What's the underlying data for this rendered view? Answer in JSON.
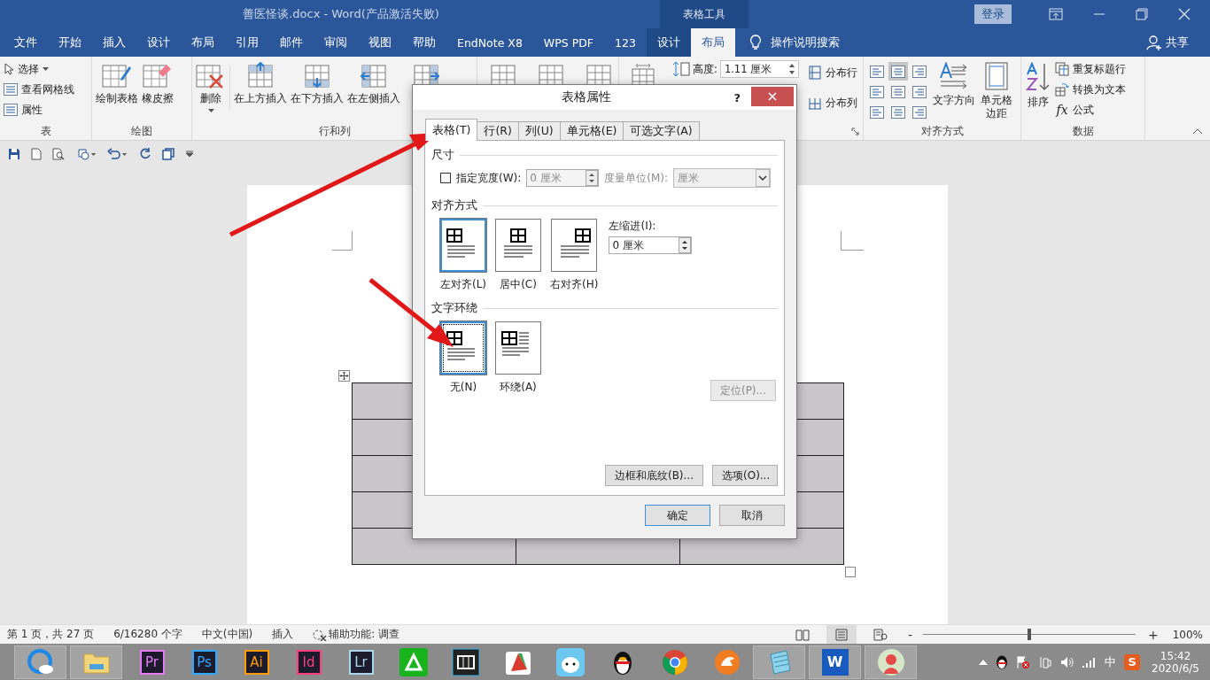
{
  "window": {
    "title": "善医怪谈.docx  -  Word(产品激活失败)",
    "context_group": "表格工具",
    "login": "登录"
  },
  "menu_tabs": [
    {
      "label": "文件",
      "kind": "main",
      "selected": false
    },
    {
      "label": "开始",
      "kind": "main",
      "selected": false
    },
    {
      "label": "插入",
      "kind": "main",
      "selected": false
    },
    {
      "label": "设计",
      "kind": "main",
      "selected": false
    },
    {
      "label": "布局",
      "kind": "main",
      "selected": false
    },
    {
      "label": "引用",
      "kind": "main",
      "selected": false
    },
    {
      "label": "邮件",
      "kind": "main",
      "selected": false
    },
    {
      "label": "审阅",
      "kind": "main",
      "selected": false
    },
    {
      "label": "视图",
      "kind": "main",
      "selected": false
    },
    {
      "label": "帮助",
      "kind": "main",
      "selected": false
    },
    {
      "label": "EndNote X8",
      "kind": "main",
      "selected": false
    },
    {
      "label": "WPS PDF",
      "kind": "main",
      "selected": false
    },
    {
      "label": "123",
      "kind": "main",
      "selected": false
    },
    {
      "label": "设计",
      "kind": "context",
      "selected": false
    },
    {
      "label": "布局",
      "kind": "context",
      "selected": true
    }
  ],
  "tell_me": "操作说明搜索",
  "share": "共享",
  "ribbon": {
    "table_group": {
      "label": "表",
      "select": "选择",
      "gridlines": "查看网格线",
      "properties": "属性"
    },
    "draw_group": {
      "label": "绘图",
      "draw_table": "绘制表格",
      "eraser": "橡皮擦"
    },
    "rows_cols_group": {
      "label": "行和列",
      "delete": "删除",
      "insert_above": "在上方插入",
      "insert_below": "在下方插入",
      "insert_left": "在左侧插入"
    },
    "cell_size_group": {
      "height_label": "高度:",
      "height_value": "1.11 厘米",
      "distribute_rows": "分布行",
      "distribute_cols": "分布列"
    },
    "alignment_group": {
      "label": "对齐方式",
      "alignments": [
        {
          "selected": false
        },
        {
          "selected": true
        },
        {
          "selected": false
        },
        {
          "selected": false
        },
        {
          "selected": false
        },
        {
          "selected": false
        },
        {
          "selected": false
        },
        {
          "selected": false
        },
        {
          "selected": false
        }
      ],
      "text_direction": "文字方向",
      "cell_margins": "单元格边距"
    },
    "data_group": {
      "label": "数据",
      "sort": "排序",
      "repeat_header": "重复标题行",
      "convert_to_text": "转换为文本",
      "formula_symbol": "fx",
      "formula": "公式"
    }
  },
  "dialog": {
    "title": "表格属性",
    "help": "?",
    "tabs": [
      {
        "label": "表格(T)",
        "selected": true
      },
      {
        "label": "行(R)",
        "selected": false
      },
      {
        "label": "列(U)",
        "selected": false
      },
      {
        "label": "单元格(E)",
        "selected": false
      },
      {
        "label": "可选文字(A)",
        "selected": false
      }
    ],
    "size": {
      "heading": "尺寸",
      "width_check": {
        "label": "指定宽度(W):",
        "checked": false
      },
      "width_field": {
        "value": "0 厘米",
        "disabled": true
      },
      "unit_label": "度量单位(M):",
      "unit_select": {
        "value": "厘米",
        "disabled": true
      }
    },
    "alignment": {
      "heading": "对齐方式",
      "options": [
        {
          "label": "左对齐(L)",
          "kind": "left",
          "selected": true
        },
        {
          "label": "居中(C)",
          "kind": "center",
          "selected": false
        },
        {
          "label": "右对齐(H)",
          "kind": "right",
          "selected": false
        }
      ],
      "indent_label": "左缩进(I):",
      "indent_value": "0 厘米"
    },
    "wrapping": {
      "heading": "文字环绕",
      "options": [
        {
          "label": "无(N)",
          "kind": "none",
          "selected": true
        },
        {
          "label": "环绕(A)",
          "kind": "around",
          "selected": false
        }
      ],
      "position_button": {
        "label": "定位(P)...",
        "disabled": true
      }
    },
    "borders_button": "边框和底纹(B)...",
    "options_button": "选项(O)...",
    "ok": "确定",
    "cancel": "取消"
  },
  "document": {
    "table": {
      "selected": true
    }
  },
  "status_bar": {
    "page": "第 1 页，共 27 页",
    "words": "6/16280 个字",
    "language": "中文(中国)",
    "mode": "插入",
    "accessibility": "辅助功能: 调查",
    "views": [
      {
        "selected": false
      },
      {
        "selected": true
      },
      {
        "selected": false
      }
    ],
    "zoom_out": "-",
    "zoom": {
      "level": 0.5
    },
    "zoom_in": "+",
    "zoom_percent": "100%"
  },
  "taskbar": {
    "apps": [
      {
        "kind": "cloud-browser",
        "open": true
      },
      {
        "kind": "folder",
        "open": true
      },
      {
        "kind": "adobe",
        "label": "Pr",
        "color": "#e77bf8",
        "open": false
      },
      {
        "kind": "adobe",
        "label": "Ps",
        "color": "#31a8ff",
        "open": false
      },
      {
        "kind": "adobe",
        "label": "Ai",
        "color": "#ff9a00",
        "open": false
      },
      {
        "kind": "adobe",
        "label": "Id",
        "color": "#ff3d7f",
        "open": false
      },
      {
        "kind": "adobe",
        "label": "Lr",
        "color": "#add5ec",
        "open": false
      },
      {
        "kind": "green-app",
        "open": false
      },
      {
        "kind": "film",
        "open": false
      },
      {
        "kind": "chart-app",
        "open": false
      },
      {
        "kind": "cat-app",
        "open": false
      },
      {
        "kind": "penguin",
        "open": false
      },
      {
        "kind": "chrome",
        "open": false
      },
      {
        "kind": "fox",
        "open": false
      },
      {
        "kind": "notepad",
        "open": true
      },
      {
        "kind": "word",
        "label": "W",
        "open": true
      },
      {
        "kind": "avatar",
        "open": true
      }
    ],
    "ime": "中",
    "ime_logo": "S",
    "time": "15:42",
    "date": "2020/6/5"
  }
}
